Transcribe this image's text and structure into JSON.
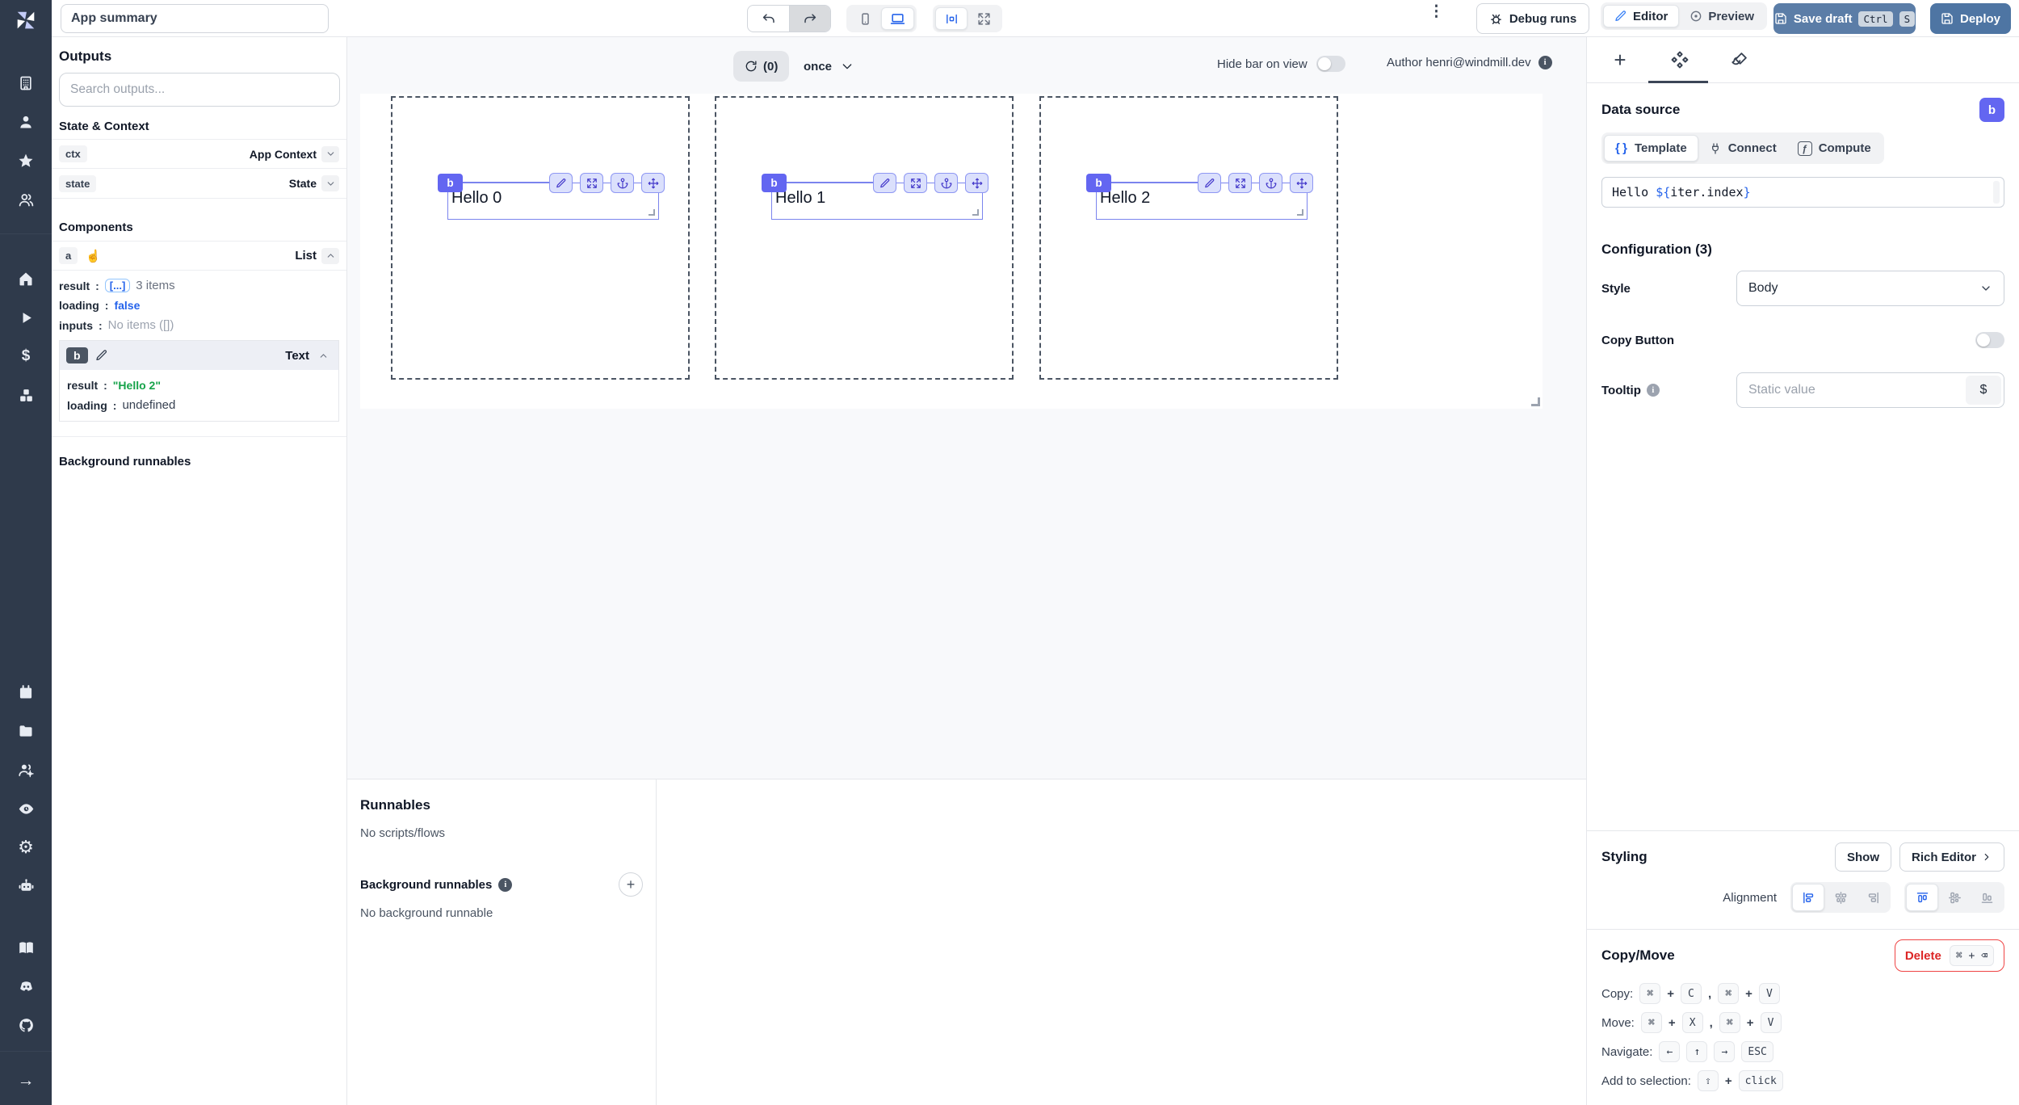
{
  "header": {
    "app_title": "App summary",
    "debug_runs_label": "Debug runs",
    "editor_label": "Editor",
    "preview_label": "Preview",
    "save_draft_label": "Save draft",
    "save_kbd": [
      "Ctrl",
      "S"
    ],
    "deploy_label": "Deploy"
  },
  "rail": {
    "groups": {
      "top": [
        "building",
        "user",
        "star",
        "user-group"
      ],
      "mid": [
        "home",
        "play",
        "dollar",
        "resources"
      ],
      "lower": [
        "calendar",
        "folder",
        "worker-group",
        "eye",
        "settings",
        "robot"
      ],
      "bottom": [
        "book",
        "discord",
        "github"
      ]
    },
    "expand": "arrow-right"
  },
  "outputs": {
    "title": "Outputs",
    "search_placeholder": "Search outputs...",
    "state_context_title": "State & Context",
    "ctx_key": "ctx",
    "ctx_type": "App Context",
    "state_key": "state",
    "state_type": "State",
    "components_title": "Components",
    "comp_a": {
      "key": "a",
      "type": "List",
      "result_chip": "[...]",
      "result_extra": "3 items",
      "loading": "false",
      "inputs": "No items ([])"
    },
    "comp_b": {
      "key": "b",
      "type": "Text",
      "result": "\"Hello 2\"",
      "loading": "undefined"
    },
    "background_title": "Background runnables",
    "labels": {
      "result": "result",
      "loading": "loading",
      "inputs": "inputs",
      "colon": ":"
    }
  },
  "canvas": {
    "refresh_count": "(0)",
    "mode": "once",
    "hide_bar_label": "Hide bar on view",
    "author_label": "Author henri@windmill.dev",
    "items": [
      {
        "badge": "b",
        "text": "Hello 0"
      },
      {
        "badge": "b",
        "text": "Hello 1"
      },
      {
        "badge": "b",
        "text": "Hello 2"
      }
    ]
  },
  "runnables": {
    "title": "Runnables",
    "empty": "No scripts/flows",
    "background_title": "Background runnables",
    "background_empty": "No background runnable"
  },
  "inspector": {
    "data_source_title": "Data source",
    "selected_badge": "b",
    "tabs": {
      "template": "Template",
      "connect": "Connect",
      "compute": "Compute"
    },
    "template": {
      "prefix": "Hello ",
      "open": "${",
      "expr": "iter.index",
      "close": "}"
    },
    "config_title": "Configuration (3)",
    "style_label": "Style",
    "style_value": "Body",
    "copy_button_label": "Copy Button",
    "tooltip_label": "Tooltip",
    "tooltip_placeholder": "Static value",
    "tooltip_btn": "$",
    "styling_title": "Styling",
    "show_label": "Show",
    "rich_editor_label": "Rich Editor",
    "alignment_label": "Alignment",
    "copymove_title": "Copy/Move",
    "delete_label": "Delete",
    "delete_kbd": "⌘ + ⌫",
    "plus": "+",
    "comma": ",",
    "rows": {
      "copy": {
        "label": "Copy:",
        "k1": "⌘",
        "k2": "C",
        "k3": "⌘",
        "k4": "V"
      },
      "move": {
        "label": "Move:",
        "k1": "⌘",
        "k2": "X",
        "k3": "⌘",
        "k4": "V"
      },
      "navigate": {
        "label": "Navigate:",
        "k1": "←",
        "k2": "↑",
        "k3": "→",
        "k4": "ESC"
      },
      "selection": {
        "label": "Add to selection:",
        "k1": "⇧",
        "k2": "click"
      }
    }
  },
  "colors": {
    "accent_indigo": "#6366f1",
    "accent_blue": "#2563eb",
    "steel_blue": "#5b7da7",
    "green": "#16a34a",
    "red": "#dc2626",
    "rail_bg": "#2f3a4b"
  }
}
